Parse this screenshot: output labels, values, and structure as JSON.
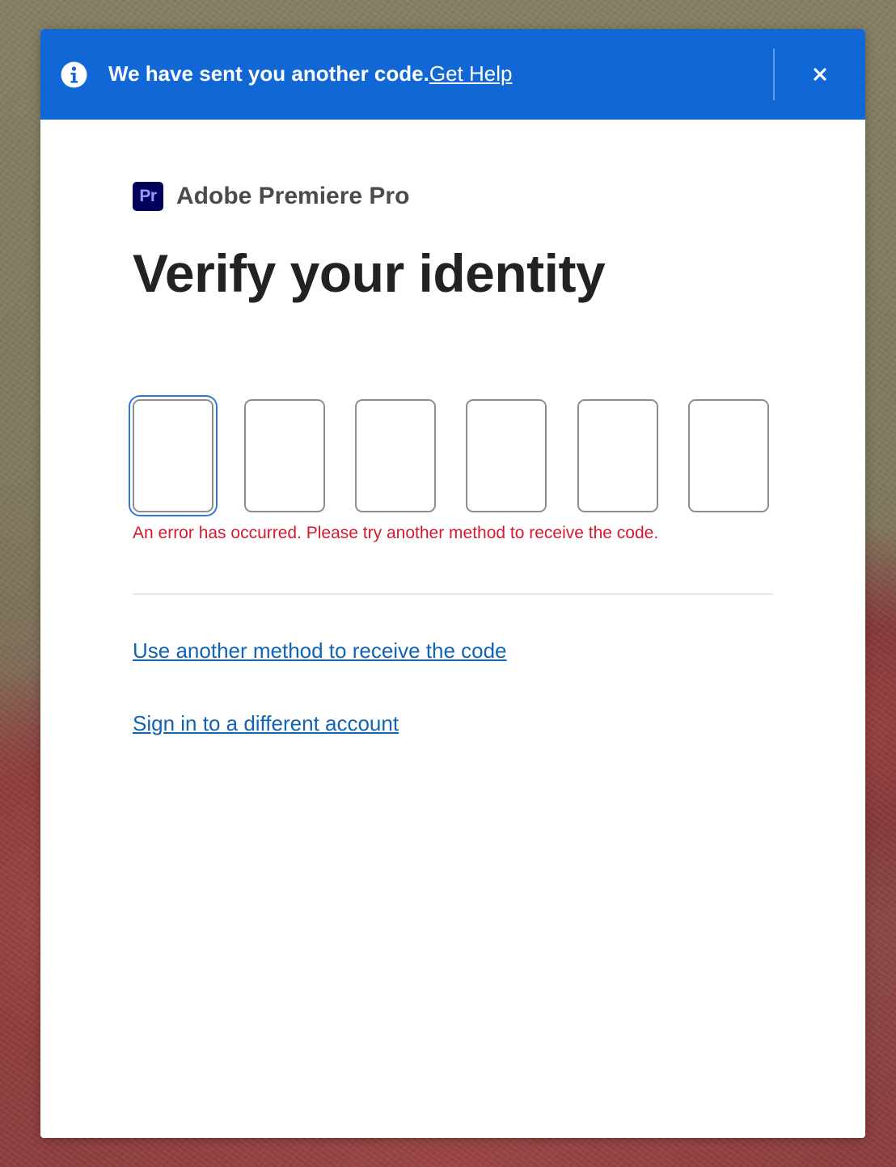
{
  "toast": {
    "message": "We have sent you another code.",
    "help_link": "Get Help",
    "info_icon": "info-icon",
    "close_icon": "close-icon",
    "background_color": "#1167d4"
  },
  "product": {
    "logo_text": "Pr",
    "name": "Adobe Premiere Pro",
    "logo_bg_color": "#00005b",
    "logo_text_color": "#9999ff"
  },
  "main": {
    "title": "Verify your identity",
    "code_inputs": [
      {
        "value": ""
      },
      {
        "value": ""
      },
      {
        "value": ""
      },
      {
        "value": ""
      },
      {
        "value": ""
      },
      {
        "value": ""
      }
    ],
    "error_message": "An error has occurred. Please try another method to receive the code.",
    "error_color": "#d31a2c",
    "link_color": "#1164b4",
    "links": {
      "another_method": "Use another method to receive the code",
      "different_account": "Sign in to a different account"
    }
  }
}
